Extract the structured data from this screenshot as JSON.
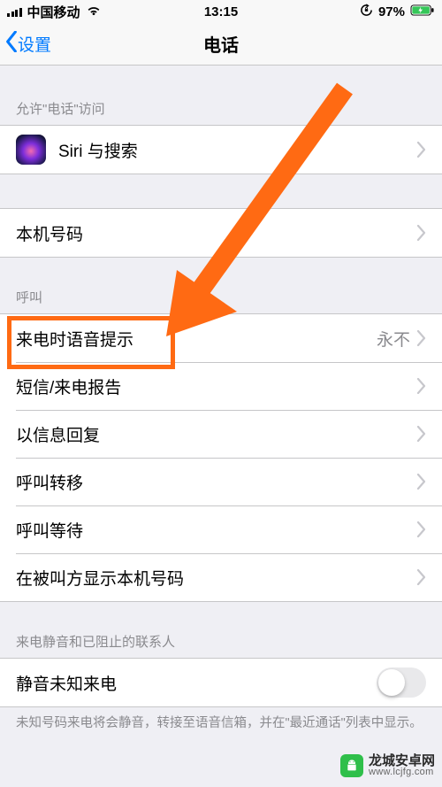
{
  "status": {
    "carrier": "中国移动",
    "time": "13:15",
    "battery_pct": "97%"
  },
  "nav": {
    "back_label": "设置",
    "title": "电话"
  },
  "section_access": {
    "header": "允许\"电话\"访问",
    "siri_search": "Siri 与搜索"
  },
  "section_number": {
    "my_number": "本机号码"
  },
  "section_calls": {
    "header": "呼叫",
    "announce_calls": {
      "label": "来电时语音提示",
      "value": "永不"
    },
    "sms_reports": "短信/来电报告",
    "respond_with_text": "以信息回复",
    "call_forwarding": "呼叫转移",
    "call_waiting": "呼叫等待",
    "show_my_caller_id": "在被叫方显示本机号码"
  },
  "section_silence": {
    "header": "来电静音和已阻止的联系人",
    "silence_unknown": "静音未知来电",
    "footnote": "未知号码来电将会静音，转接至语音信箱，并在\"最近通话\"列表中显示。"
  },
  "annotation": {
    "arrow_color": "#ff6a13",
    "highlight_color": "#ff6a13"
  },
  "watermark": {
    "line1": "龙城安卓网",
    "line2": "www.lcjfg.com"
  }
}
